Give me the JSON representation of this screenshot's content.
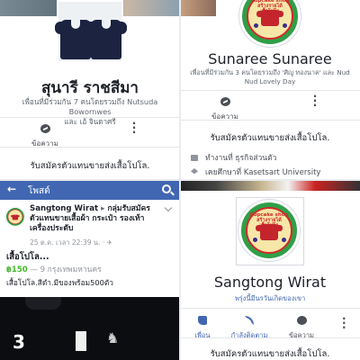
{
  "q1": {
    "name": "สุนารี ราชสีมา",
    "friends_line1": "เพื่อนที่มีร่วมกัน 7 คนโดยรวมถึง Nutsuda Bowornwes",
    "friends_line2": "และ เอ้ จินดาศรี",
    "message_label": "ข้อความ",
    "subscribe_text": "รับสมัครตัวแทนขายส่งเสื้อโปโล."
  },
  "q2": {
    "logo_text": "Cupcake shop\nสร้างรายได้\nเสื้อโปโล",
    "name": "Sunaree Sunaree",
    "friends_line1": "เพื่อนที่มีร่วมกัน 3 คนโดยรวมถึง 'ศิญู ทองนาค' และ Nud",
    "friends_line2": "Nud Lovely Day",
    "message_label": "ข้อความ",
    "subscribe_text": "รับสมัครตัวแทนขายส่งเสื้อโปโล.",
    "work": "ทำงานที่ ธุรกิจส่วนตัว",
    "education": "เคยศึกษาที่ Kasetsart University"
  },
  "q3": {
    "back_arrow": "←",
    "title": "โพสต์",
    "author": "Sangtong Wirat",
    "arrow": "▸",
    "group": "กลุ่มรับสมัครตัวแทนขายเสื้อผ้า กระเป๋า รองเท้า เครื่องประดับ",
    "meta": "25 ต.ค. เวลา 22:39 น. · ✈",
    "post_title": "เสื้อโปโล...",
    "price": "฿150",
    "location": "— 9 กรุงเทพมหานคร",
    "description": "เสื้อโปโล.สีดำ.มีของพร้อม500ตัว",
    "photo_number": "3"
  },
  "q4": {
    "name": "Sangtong Wirat",
    "subtitle": "พรุ่งนี้มีนรวันเกิดของเขา",
    "btn_friend": "เพื่อน",
    "btn_follow": "กำลังติดตาม",
    "btn_message": "ข้อความ",
    "subscribe_text": "รับสมัครตัวแทนขายส่งเสื้อโปโล."
  },
  "colors": {
    "facebook_blue": "#4267b2",
    "price_green": "#42b72a",
    "logo_green": "#2e9f47",
    "logo_red": "#c4252c"
  },
  "icons": [
    "messenger-icon",
    "more-icon",
    "briefcase-icon",
    "graduation-cap-icon",
    "back-arrow-icon",
    "search-icon",
    "friend-icon",
    "rss-icon"
  ]
}
